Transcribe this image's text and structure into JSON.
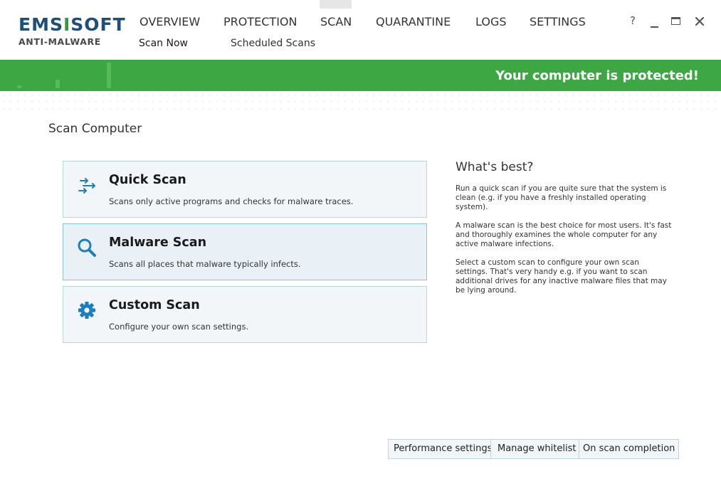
{
  "app": {
    "logo_part1": "EMS",
    "logo_part2": "I",
    "logo_part3": "SOFT",
    "logo_subtitle": "ANTI-MALWARE"
  },
  "nav": {
    "items": [
      "OVERVIEW",
      "PROTECTION",
      "SCAN",
      "QUARANTINE",
      "LOGS",
      "SETTINGS"
    ],
    "active": "SCAN",
    "subitems": [
      "Scan Now",
      "Scheduled Scans"
    ],
    "active_subitem": "Scan Now"
  },
  "window_controls": {
    "help": "?"
  },
  "status": {
    "text": "Your computer is protected!",
    "color": "#3da744"
  },
  "main": {
    "title": "Scan Computer",
    "scans": [
      {
        "title": "Quick Scan",
        "desc": "Scans only active programs and checks for malware traces.",
        "icon": "arrows-icon"
      },
      {
        "title": "Malware Scan",
        "desc": "Scans all places that malware typically infects.",
        "icon": "magnifier-icon"
      },
      {
        "title": "Custom Scan",
        "desc": "Configure your own scan settings.",
        "icon": "gear-icon"
      }
    ],
    "selected_scan": "Malware Scan"
  },
  "whats_best": {
    "title": "What's best?",
    "paragraphs": [
      "Run a quick scan if you are quite sure that the system is clean (e.g. if you have a freshly installed operating system).",
      "A malware scan is the best choice for most users. It's fast and thoroughly examines the whole computer for any active malware infections.",
      "Select a custom scan to configure your own scan settings. That's very handy e.g. if you want to scan additional drives for any inactive malware files that may be lying around."
    ]
  },
  "buttons": {
    "performance": "Performance settings",
    "whitelist": "Manage whitelist",
    "completion": "On scan completion"
  },
  "colors": {
    "accent": "#1b7fbd",
    "brand_blue": "#1d4f7a",
    "brand_green": "#2f9e3d"
  }
}
